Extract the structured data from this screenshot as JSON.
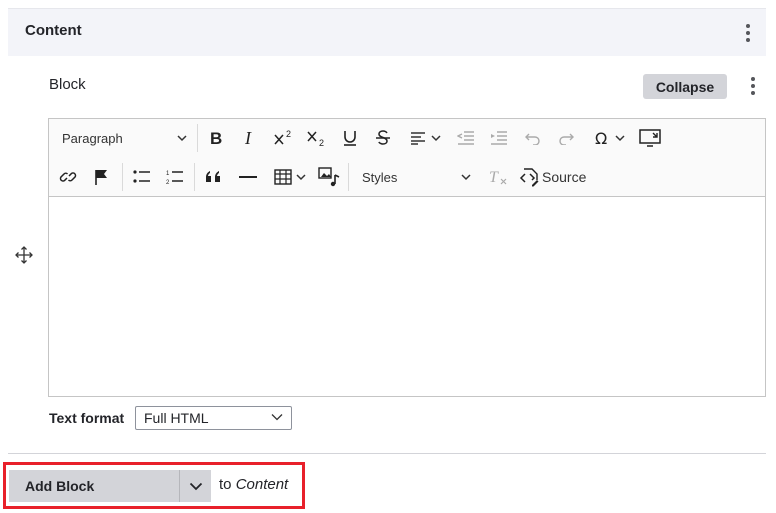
{
  "section": {
    "title": "Content"
  },
  "block": {
    "label": "Block",
    "collapse_label": "Collapse"
  },
  "editor": {
    "paragraph_label": "Paragraph",
    "styles_label": "Styles",
    "source_label": "Source",
    "content": ""
  },
  "text_format": {
    "label": "Text format",
    "value": "Full HTML"
  },
  "add_block": {
    "button_label": "Add Block",
    "to_prefix": "to",
    "to_target": "Content"
  },
  "colors": {
    "highlight": "#e8202a",
    "button_bg": "#d3d4d9",
    "header_bg": "#f3f4f9"
  },
  "icons": [
    "more-vertical-icon",
    "move-icon",
    "bold-icon",
    "italic-icon",
    "superscript-icon",
    "subscript-icon",
    "underline-icon",
    "strikethrough-icon",
    "align-icon",
    "outdent-icon",
    "indent-icon",
    "undo-icon",
    "redo-icon",
    "special-characters-icon",
    "fullscreen-icon",
    "link-icon",
    "anchor-flag-icon",
    "bulleted-list-icon",
    "numbered-list-icon",
    "blockquote-icon",
    "horizontal-line-icon",
    "table-icon",
    "media-icon",
    "remove-format-icon",
    "source-icon",
    "chevron-down-icon"
  ]
}
